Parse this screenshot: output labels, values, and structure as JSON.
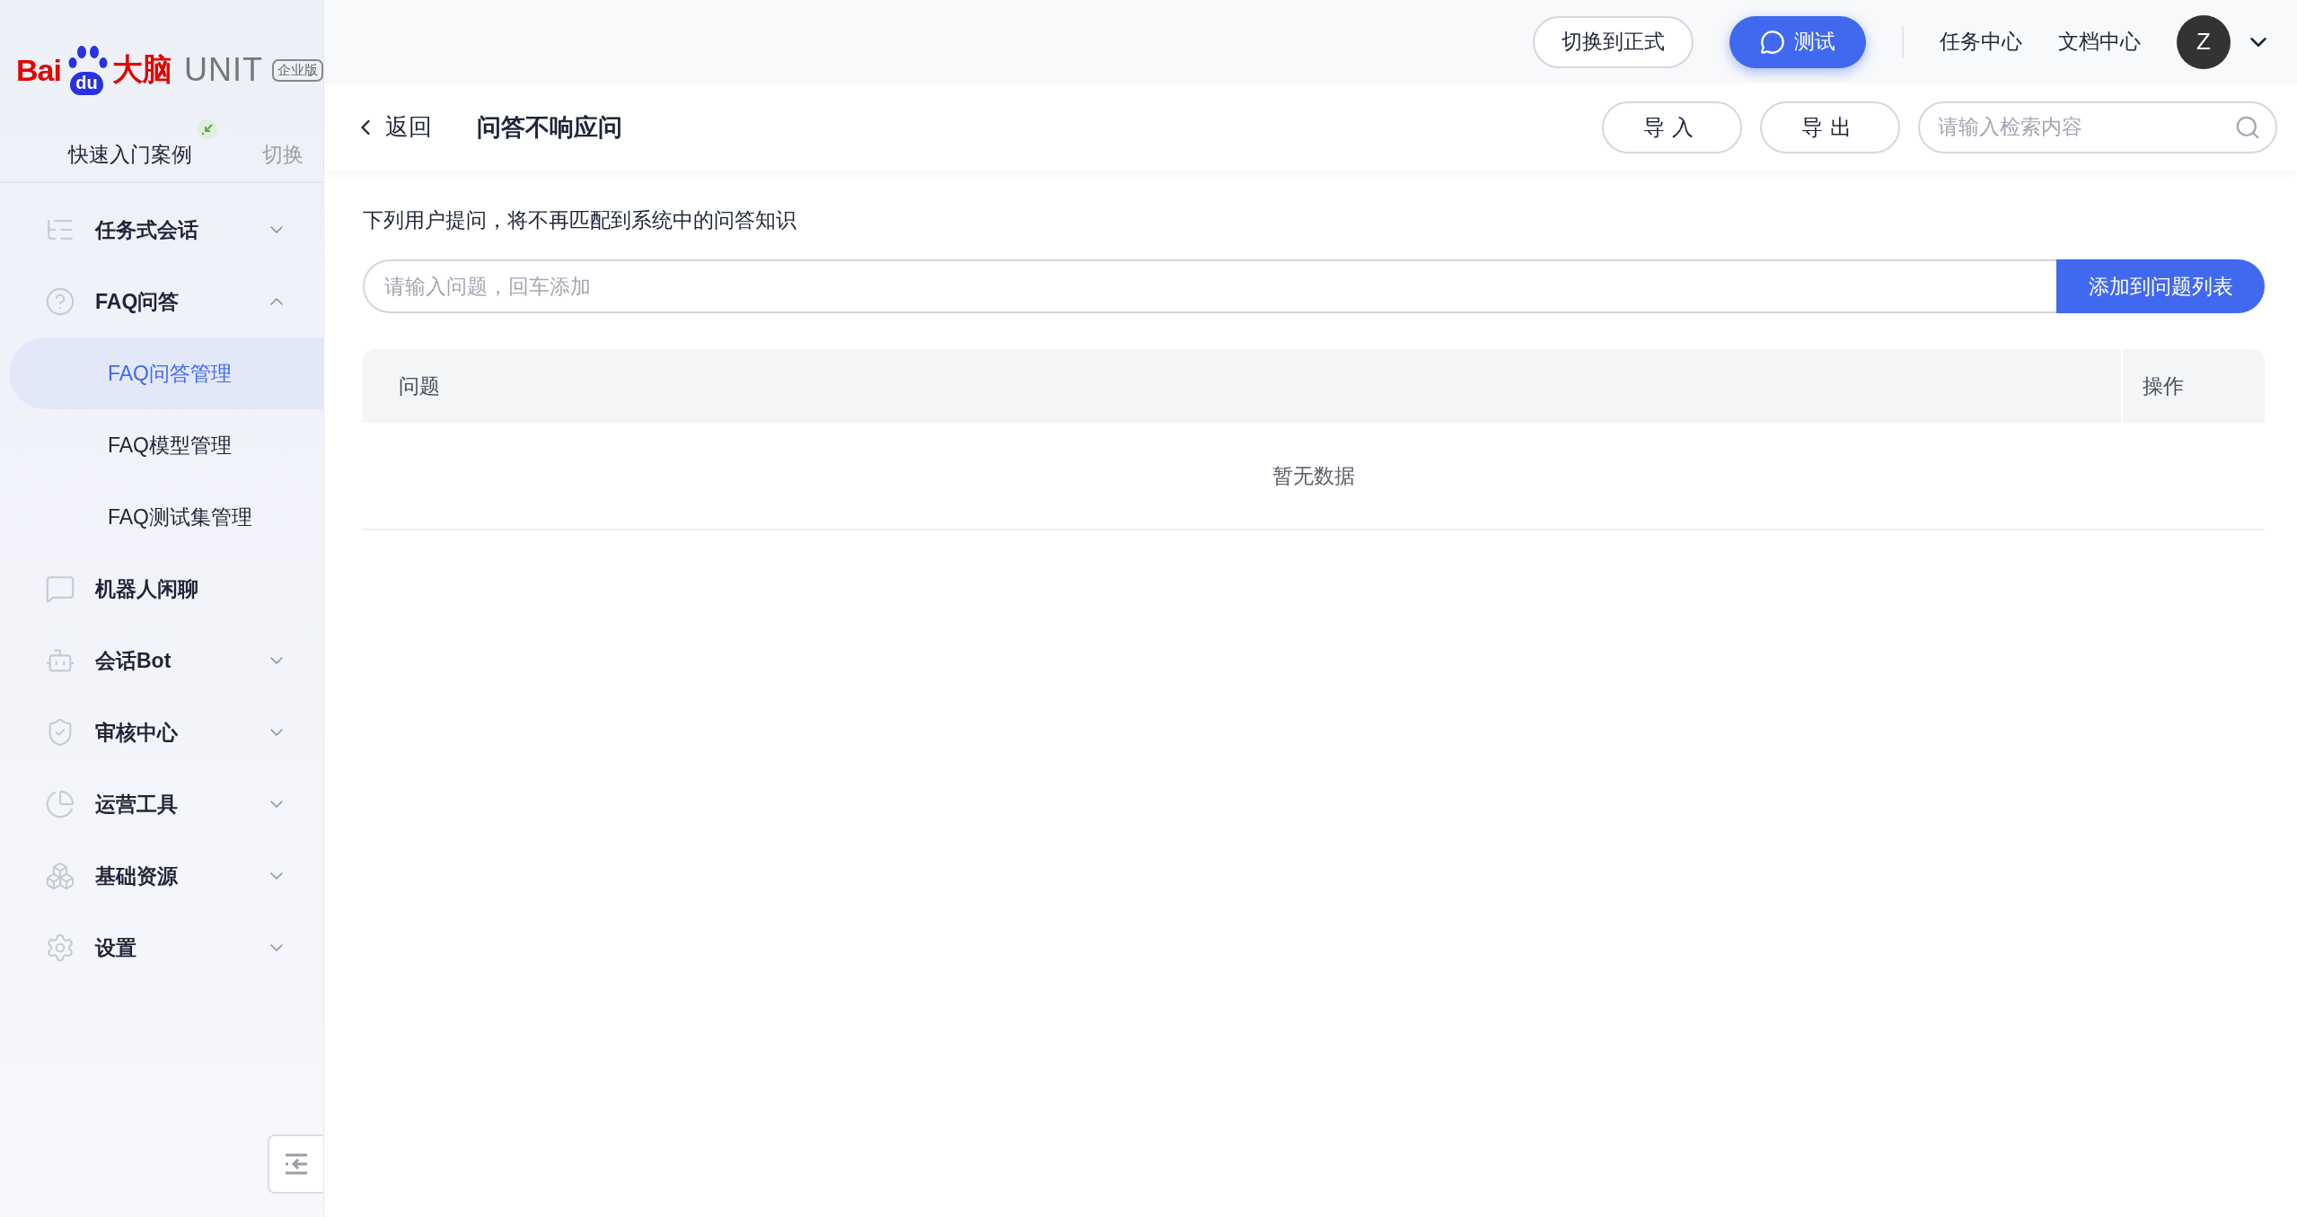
{
  "logo": {
    "brand_left": "Bai",
    "brand_paw": "du",
    "brand_cn": "大脑",
    "product": "UNIT",
    "edition": "企业版"
  },
  "workspace": {
    "name": "快速入门案例",
    "switch": "切换"
  },
  "nav": [
    {
      "kind": "group",
      "label": "任务式会话",
      "expanded": false
    },
    {
      "kind": "group",
      "label": "FAQ问答",
      "expanded": true,
      "children": [
        {
          "label": "FAQ问答管理",
          "selected": true
        },
        {
          "label": "FAQ模型管理",
          "selected": false
        },
        {
          "label": "FAQ测试集管理",
          "selected": false
        }
      ]
    },
    {
      "kind": "link",
      "label": "机器人闲聊"
    },
    {
      "kind": "group",
      "label": "会话Bot",
      "expanded": false
    },
    {
      "kind": "group",
      "label": "审核中心",
      "expanded": false
    },
    {
      "kind": "group",
      "label": "运营工具",
      "expanded": false
    },
    {
      "kind": "group",
      "label": "基础资源",
      "expanded": false
    },
    {
      "kind": "group",
      "label": "设置",
      "expanded": false
    }
  ],
  "topbar": {
    "switch_button": "切换到正式",
    "test_button": "测试",
    "links": [
      "任务中心",
      "文档中心"
    ],
    "avatar": "Z"
  },
  "subheader": {
    "back": "返回",
    "title": "问答不响应问",
    "buttons": [
      "导入",
      "导出"
    ],
    "search": {
      "placeholder": "请输入检索内容"
    }
  },
  "content": {
    "description": "下列用户提问，将不再匹配到系统中的问答知识",
    "question_input": {
      "placeholder": "请输入问题，回车添加"
    },
    "add_button": "添加到问题列表",
    "table": {
      "columns": [
        "问题",
        "操作"
      ],
      "empty": "暂无数据"
    }
  }
}
